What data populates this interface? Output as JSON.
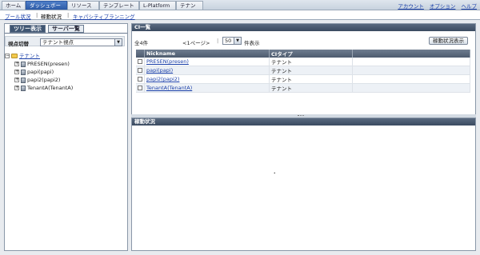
{
  "nav": {
    "tabs": [
      {
        "label": "ホーム"
      },
      {
        "label": "ダッシュボード"
      },
      {
        "label": "リソース"
      },
      {
        "label": "テンプレート"
      },
      {
        "label": "L-Platform"
      },
      {
        "label": "テナント"
      }
    ],
    "links": [
      {
        "label": "アカウント"
      },
      {
        "label": "オプション"
      },
      {
        "label": "ヘルプ"
      }
    ]
  },
  "subnav": {
    "items": [
      {
        "label": "プール状況"
      },
      {
        "label": "稼動状況"
      },
      {
        "label": "キャパシティプランニング"
      }
    ]
  },
  "left": {
    "tabs": [
      {
        "label": "ツリー表示"
      },
      {
        "label": "サーバ一覧"
      }
    ],
    "viewpoint_label": "視点切替",
    "viewpoint_value": "テナント視点",
    "tree": {
      "root": "テナント",
      "children": [
        {
          "label": "PRESEN(presen)"
        },
        {
          "label": "papi(papi)"
        },
        {
          "label": "papi2(papi2)"
        },
        {
          "label": "TenantA(TenantA)"
        }
      ]
    }
  },
  "ci_list": {
    "title": "CI一覧",
    "count_text": "全4件",
    "page_text": "<1ページ>",
    "per_page": "50",
    "per_page_suffix": "件表示",
    "status_button": "稼動状況表示",
    "columns": [
      "Nickname",
      "CIタイプ"
    ],
    "rows": [
      {
        "nickname": "PRESEN(presen)",
        "type": "テナント"
      },
      {
        "nickname": "papi(papi)",
        "type": "テナント"
      },
      {
        "nickname": "papi2(papi2)",
        "type": "テナント"
      },
      {
        "nickname": "TenantA(TenantA)",
        "type": "テナント"
      }
    ]
  },
  "status_panel": {
    "title": "稼動状況",
    "dot": "."
  }
}
